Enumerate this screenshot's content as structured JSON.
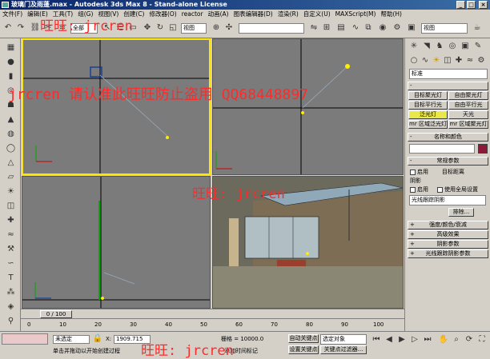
{
  "window": {
    "title": "玻璃门及雨蓬.max - Autodesk 3ds Max 8 - Stand-alone License",
    "min_label": "_",
    "max_label": "□",
    "close_label": "×"
  },
  "menu": [
    "文件(F)",
    "编辑(E)",
    "工具(T)",
    "组(G)",
    "视图(V)",
    "创建(C)",
    "修改器(O)",
    "reactor",
    "动画(A)",
    "图表编辑器(D)",
    "渲染(R)",
    "自定义(U)",
    "MAXScript(M)",
    "帮助(H)"
  ],
  "toolbar": {
    "selection_filter": "全部",
    "view_coord": "视图",
    "named_selection": "",
    "right_dropdown": "视图"
  },
  "viewports": {
    "bottom_right_label": ""
  },
  "command_panel": {
    "category_dropdown": "标准",
    "light_buttons": [
      {
        "label": "目标聚光灯",
        "on": false
      },
      {
        "label": "自由聚光灯",
        "on": false
      },
      {
        "label": "目标平行光",
        "on": false
      },
      {
        "label": "自由平行光",
        "on": false
      },
      {
        "label": "泛光灯",
        "on": true
      },
      {
        "label": "天光",
        "on": false
      },
      {
        "label": "mr 区域泛光灯",
        "on": false
      },
      {
        "label": "mr 区域聚光灯",
        "on": false
      }
    ],
    "name_color_rollup": "名称和颜色",
    "general_params_rollup": "常规参数",
    "enable_label": "启用",
    "targeted_label": "目标距离",
    "shadows_label": "阴影",
    "shadows_enable": "启用",
    "use_global": "使用全局设置",
    "shadow_type": "光线跟踪阴影",
    "exclude_button": "排除...",
    "rollups": [
      "强度/颜色/衰减",
      "高级效果",
      "阴影参数",
      "光线跟踪阴影参数"
    ]
  },
  "timeline": {
    "frame_counter": "0 / 100",
    "ticks": [
      "0",
      "10",
      "20",
      "30",
      "40",
      "50",
      "60",
      "70",
      "80",
      "90",
      "100"
    ]
  },
  "status": {
    "selection": "未选定",
    "x_label": "X:",
    "x_value": "1909.715",
    "grid_label": "栅格 = 10000.0",
    "auto_key": "自动关键点",
    "selected_dropdown": "选定对象",
    "set_key": "设置关键点",
    "key_filters": "关键点过滤器...",
    "prompt": "单击并拖动以开始创建过程",
    "add_time_tag": "添加时间标记"
  },
  "watermarks": {
    "top": "旺旺: jrcren",
    "middle_left": "jrcren 请认准此旺旺防止盗用 QQ68448897",
    "center": "旺旺: jrcren",
    "bottom": "旺旺: jrcren"
  },
  "colors": {
    "viewport_bg": "#7b7b7b",
    "active_border": "#ffe600",
    "watermark": "#ff2a2a",
    "on_button": "#e8e84a"
  }
}
